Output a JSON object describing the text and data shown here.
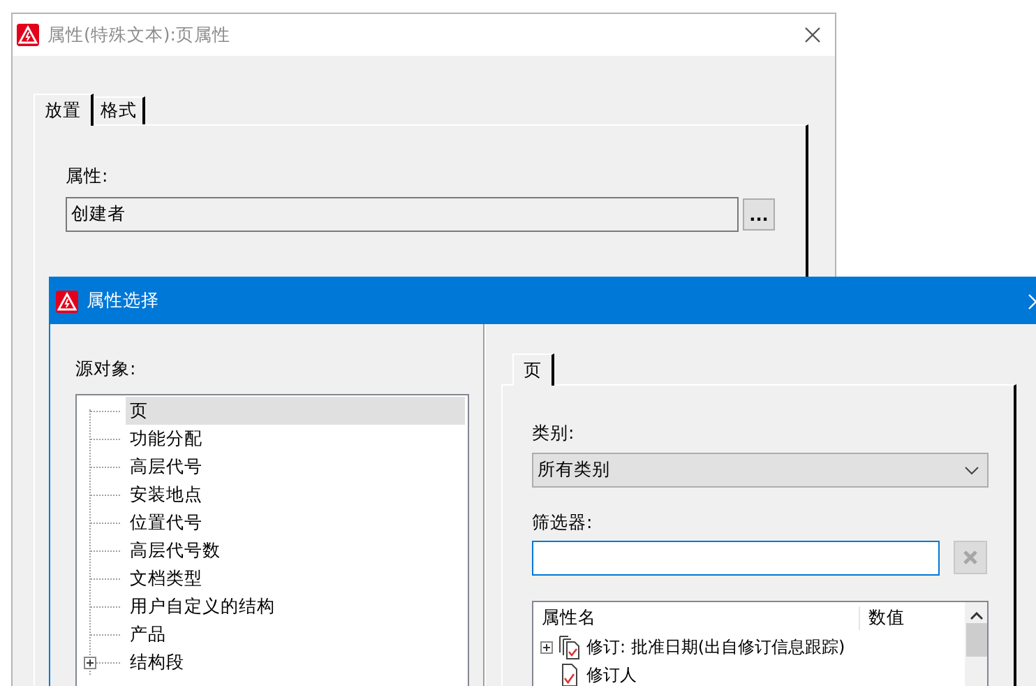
{
  "back_window": {
    "title": "属性(特殊文本):页属性",
    "tabs": [
      {
        "label": "放置",
        "selected": true
      },
      {
        "label": "格式",
        "selected": false
      }
    ],
    "property_label": "属性:",
    "property_value": "创建者",
    "browse_button": "..."
  },
  "front_window": {
    "title": "属性选择",
    "source_label": "源对象:",
    "source_tree": [
      {
        "label": "页",
        "selected": true,
        "expandable": false
      },
      {
        "label": "功能分配",
        "selected": false,
        "expandable": false
      },
      {
        "label": "高层代号",
        "selected": false,
        "expandable": false
      },
      {
        "label": "安装地点",
        "selected": false,
        "expandable": false
      },
      {
        "label": "位置代号",
        "selected": false,
        "expandable": false
      },
      {
        "label": "高层代号数",
        "selected": false,
        "expandable": false
      },
      {
        "label": "文档类型",
        "selected": false,
        "expandable": false
      },
      {
        "label": "用户自定义的结构",
        "selected": false,
        "expandable": false
      },
      {
        "label": "产品",
        "selected": false,
        "expandable": false
      },
      {
        "label": "结构段",
        "selected": false,
        "expandable": true
      }
    ],
    "tabs": [
      {
        "label": "页",
        "selected": true
      }
    ],
    "category_label": "类别:",
    "category_value": "所有类别",
    "filter_label": "筛选器:",
    "columns": [
      "属性名",
      "数值"
    ],
    "rows": [
      {
        "label": "修订: 批准日期(出自修订信息跟踪)",
        "kind": "group",
        "expandable": true
      },
      {
        "label": "修订人",
        "kind": "single",
        "expandable": false
      }
    ]
  }
}
